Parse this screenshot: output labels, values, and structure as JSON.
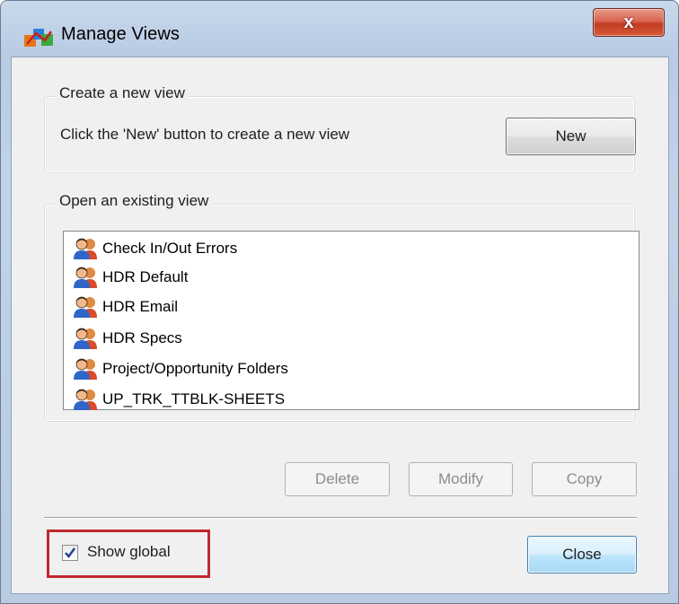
{
  "window": {
    "title": "Manage Views",
    "close_glyph": "x"
  },
  "create_group": {
    "title": "Create a new view",
    "hint": "Click the 'New' button to create a new view",
    "new_button": "New"
  },
  "open_group": {
    "title": "Open an existing view",
    "views": [
      {
        "label": "Check In/Out Errors",
        "icon": "users-icon"
      },
      {
        "label": "HDR Default",
        "icon": "users-icon"
      },
      {
        "label": "HDR Email",
        "icon": "users-icon"
      },
      {
        "label": "HDR Specs",
        "icon": "users-icon"
      },
      {
        "label": "Project/Opportunity Folders",
        "icon": "users-icon"
      },
      {
        "label": "UP_TRK_TTBLK-SHEETS",
        "icon": "users-icon"
      }
    ]
  },
  "actions": {
    "delete": "Delete",
    "modify": "Modify",
    "copy": "Copy",
    "actions_enabled": false
  },
  "footer": {
    "show_global_label": "Show global",
    "show_global_checked": true,
    "close_button": "Close"
  },
  "colors": {
    "highlight": "#c1272d",
    "close_button": "#c23c22"
  }
}
